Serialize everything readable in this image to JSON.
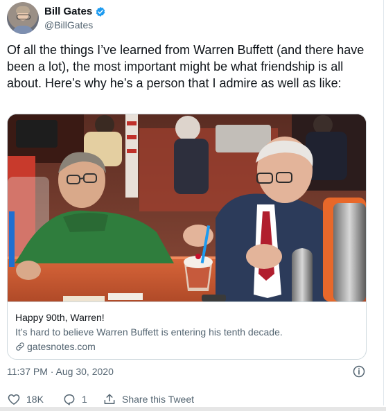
{
  "author": {
    "name": "Bill Gates",
    "handle": "@BillGates",
    "verified": true
  },
  "tweet": {
    "text": "Of all the things I’ve learned from Warren Buffett (and there have been a lot), the most important might be what friendship is all about. Here’s why he’s a person that I admire as well as like:",
    "timestamp": "11:37 PM · Aug 30, 2020"
  },
  "card": {
    "title": "Happy 90th, Warren!",
    "description": "It’s hard to believe Warren Buffett is entering his tenth decade.",
    "domain": "gatesnotes.com"
  },
  "actions": {
    "like_count": "18K",
    "reply_count": "1",
    "share_label": "Share this Tweet"
  },
  "icons": {
    "verified": "verified-badge-icon",
    "link": "link-icon",
    "info": "info-icon",
    "like": "heart-icon",
    "reply": "reply-icon",
    "share": "share-icon"
  },
  "colors": {
    "accent": "#1d9bf0",
    "text_primary": "#0f1419",
    "text_secondary": "#536471",
    "border": "#cfd9de"
  }
}
